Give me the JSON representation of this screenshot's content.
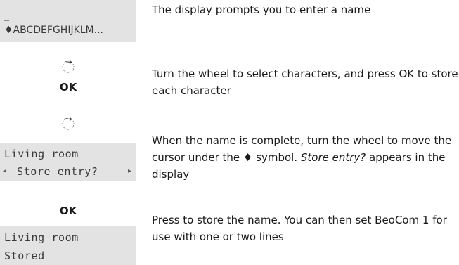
{
  "step1": {
    "display": {
      "cursor": "_",
      "charset": "♦ABCDEFGHIJKLM..."
    },
    "text": "The display prompts you to enter a name"
  },
  "step2": {
    "wheel_icon": "wheel-icon",
    "ok_label": "OK",
    "text": "Turn the wheel to select characters, and press OK to store each character"
  },
  "step3": {
    "wheel_icon": "wheel-icon",
    "display": {
      "line1": "Living room",
      "line2": "Store entry?",
      "left_arrow": "◂",
      "right_arrow": "▸"
    },
    "text_before": "When the name is complete, turn the wheel to move the cursor under the ♦ symbol. ",
    "text_italic": "Store entry?",
    "text_after": " appears in the display"
  },
  "step4": {
    "ok_label": "OK",
    "display": {
      "line1": "Living room",
      "line2": "Stored"
    },
    "text": "Press to store the name. You can then set BeoCom 1 for use with one or two lines"
  }
}
